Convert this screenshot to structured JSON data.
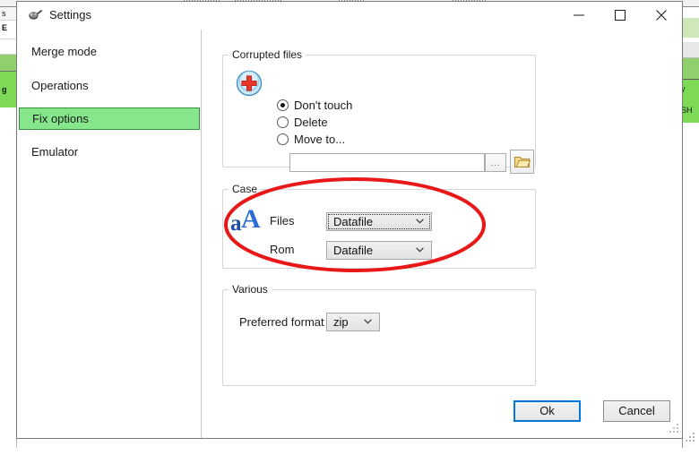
{
  "window": {
    "title": "Settings",
    "icon": "gamepad-icon",
    "controls": {
      "minimize": "minimize-icon",
      "maximize": "maximize-icon",
      "close": "close-icon"
    }
  },
  "sidebar": {
    "items": [
      {
        "label": "Merge mode",
        "selected": false
      },
      {
        "label": "Operations",
        "selected": false
      },
      {
        "label": "Fix options",
        "selected": true
      },
      {
        "label": "Emulator",
        "selected": false
      }
    ],
    "selected_color": "#86e68b",
    "selected_border": "#3a8f3e"
  },
  "groups": {
    "corrupted": {
      "legend": "Corrupted files",
      "icon": "red-cross-circle-icon",
      "radios": [
        {
          "label": "Don't touch",
          "checked": true
        },
        {
          "label": "Delete",
          "checked": false
        },
        {
          "label": "Move to...",
          "checked": false
        }
      ],
      "path_value": "",
      "path_placeholder": "",
      "browse_dots_label": "...",
      "folder_icon": "folder-icon"
    },
    "case": {
      "legend": "Case",
      "icon": "aA-letter-case-icon",
      "fields": [
        {
          "label": "Files",
          "value": "Datafile",
          "focused": true
        },
        {
          "label": "Rom",
          "value": "Datafile",
          "focused": false
        }
      ]
    },
    "various": {
      "legend": "Various",
      "format_label": "Preferred format",
      "format_value": "zip"
    }
  },
  "footer": {
    "ok_label": "Ok",
    "cancel_label": "Cancel",
    "ok_focus_color": "#0078d7"
  },
  "annotation": {
    "shape": "ellipse",
    "color": "#e81818",
    "stroke_width": 4
  },
  "background": {
    "left_fragments": [
      "s",
      "E",
      "g"
    ],
    "right_fragments": [
      "y",
      "SH"
    ],
    "highlight_color": "#7ed957"
  }
}
